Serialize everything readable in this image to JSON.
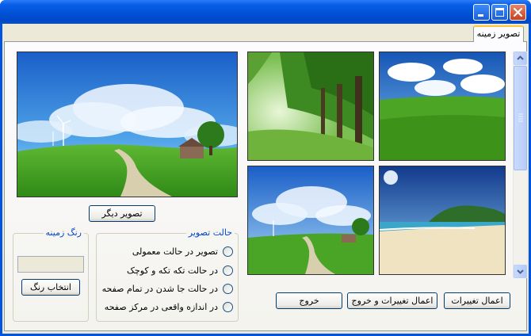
{
  "window": {
    "title": ""
  },
  "tabs": [
    {
      "label": "تصویر زمینه"
    }
  ],
  "preview": {
    "next_button": "تصویر دیگر"
  },
  "thumbnails": [
    {
      "name": "green-meadow-clouds"
    },
    {
      "name": "tree-lined-path"
    },
    {
      "name": "tropical-beach"
    },
    {
      "name": "meadow-path-house"
    }
  ],
  "bg_color_group": {
    "title": "رنگ زمینه",
    "select_button": "انتخاب رنگ",
    "current_color": "#ece9d8"
  },
  "mode_group": {
    "title": "حالت تصویر",
    "options": [
      {
        "label": "تصویر در حالت معمولی",
        "selected": false
      },
      {
        "label": "در حالت تکه تکه و کوچک",
        "selected": false
      },
      {
        "label": "در حالت جا شدن در تمام صفحه",
        "selected": false
      },
      {
        "label": "در اندازه واقعی در مرکز صفحه",
        "selected": false
      }
    ]
  },
  "actions": {
    "apply": "اعمال تغییرات",
    "apply_exit": "اعمال تغییرات و خروج",
    "exit": "خروج"
  }
}
